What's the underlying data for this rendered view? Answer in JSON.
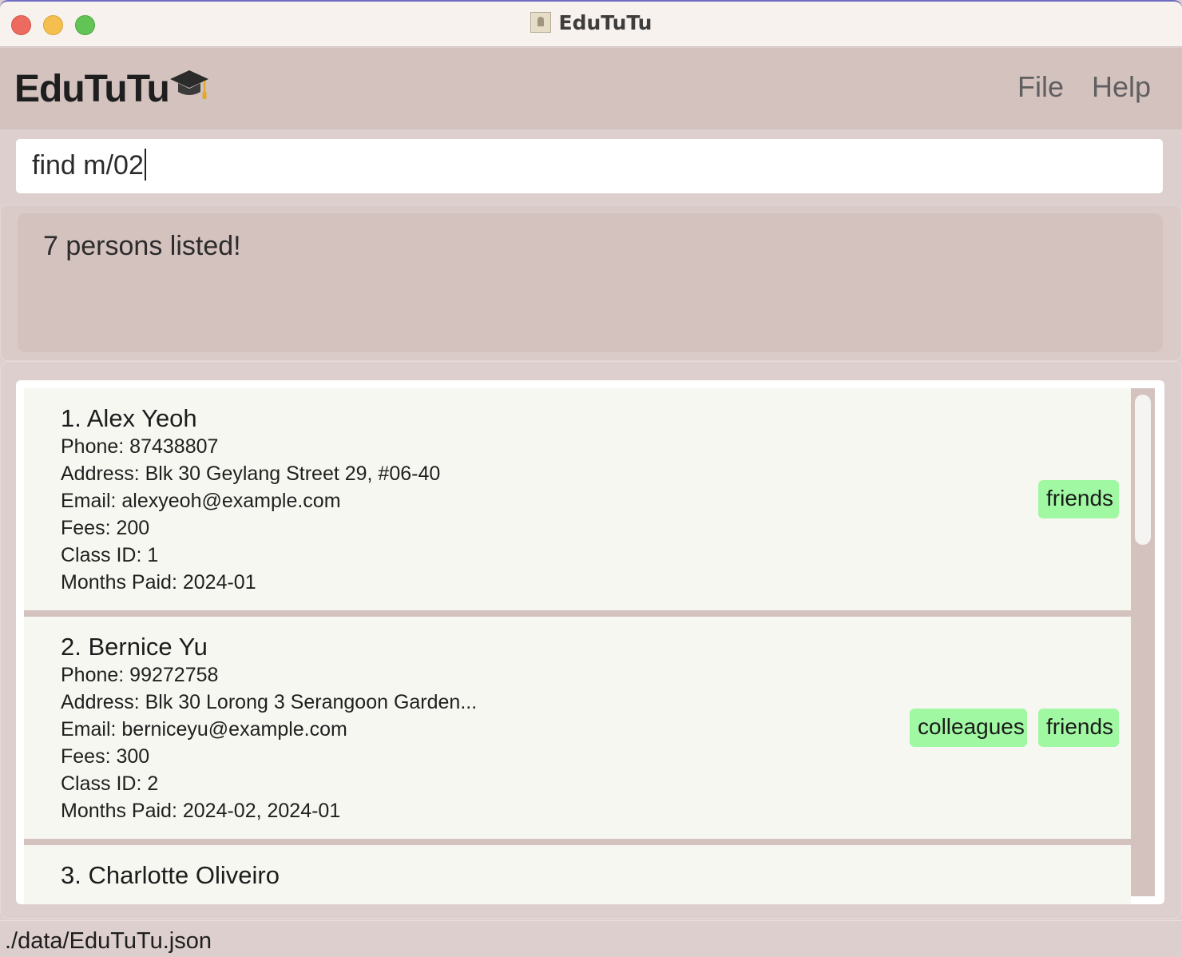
{
  "window": {
    "title": "EduTuTu"
  },
  "app": {
    "name": "EduTuTu",
    "logo_icon": "graduation-cap-icon"
  },
  "menu": {
    "file": "File",
    "help": "Help"
  },
  "command": {
    "value": "find m/02"
  },
  "result": {
    "message": "7 persons listed!"
  },
  "persons": [
    {
      "name": "1. Alex Yeoh",
      "phone": "Phone:  87438807",
      "address": "Address:  Blk 30 Geylang Street 29, #06-40",
      "email": "Email:  alexyeoh@example.com",
      "fees": "Fees:  200",
      "class_id": "Class ID:  1",
      "months_paid": "Months Paid:  2024-01",
      "tags": [
        "friends"
      ]
    },
    {
      "name": "2. Bernice Yu",
      "phone": "Phone:  99272758",
      "address": "Address:  Blk 30 Lorong 3 Serangoon Garden...",
      "email": "Email:  berniceyu@example.com",
      "fees": "Fees:  300",
      "class_id": "Class ID:  2",
      "months_paid": "Months Paid:  2024-02, 2024-01",
      "tags": [
        "colleagues",
        "friends"
      ]
    },
    {
      "name": "3. Charlotte Oliveiro"
    }
  ],
  "status": {
    "path": "./data/EduTuTu.json"
  },
  "colors": {
    "accent_bg": "#d4c2bf",
    "tag_bg": "#a1f8a2",
    "card_bg": "#f7f7f2"
  }
}
